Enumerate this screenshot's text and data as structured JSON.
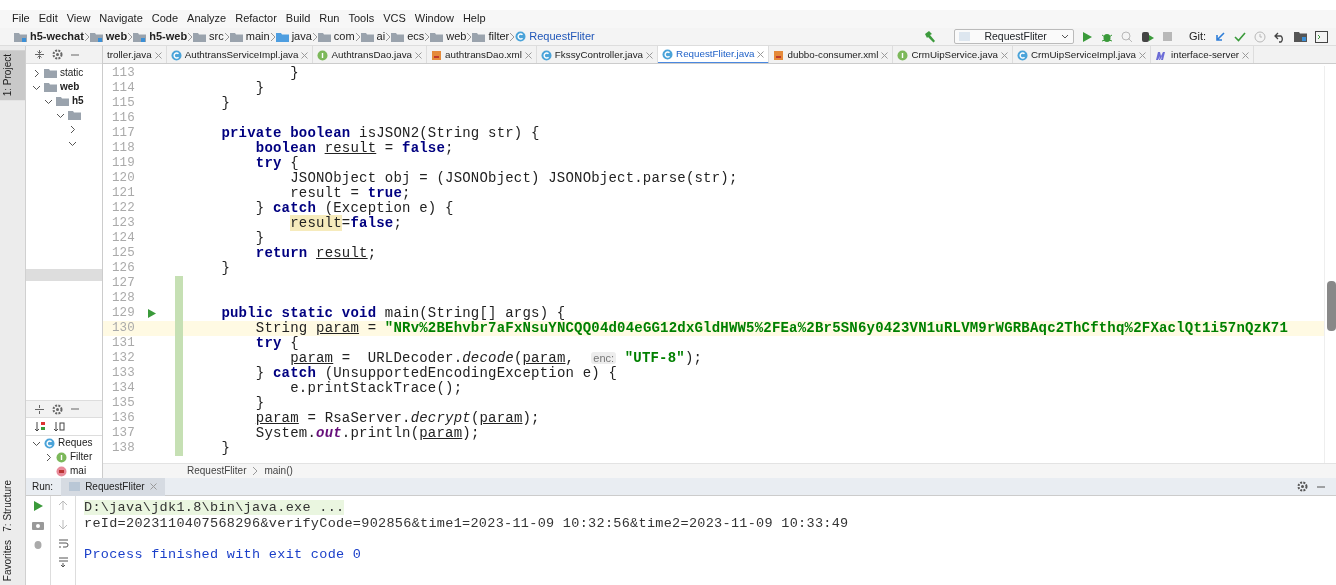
{
  "menu": [
    "File",
    "Edit",
    "View",
    "Navigate",
    "Code",
    "Analyze",
    "Refactor",
    "Build",
    "Run",
    "Tools",
    "VCS",
    "Window",
    "Help"
  ],
  "breadcrumb": [
    {
      "label": "h5-wechat",
      "kind": "module"
    },
    {
      "label": "web",
      "kind": "module"
    },
    {
      "label": "h5-web",
      "kind": "module"
    },
    {
      "label": "src",
      "kind": "folder"
    },
    {
      "label": "main",
      "kind": "folder"
    },
    {
      "label": "java",
      "kind": "source"
    },
    {
      "label": "com",
      "kind": "folder"
    },
    {
      "label": "ai",
      "kind": "folder"
    },
    {
      "label": "ecs",
      "kind": "folder"
    },
    {
      "label": "web",
      "kind": "folder"
    },
    {
      "label": "filter",
      "kind": "folder"
    },
    {
      "label": "RequestFliter",
      "kind": "class"
    }
  ],
  "toolbar": [
    {
      "kind": "build",
      "disabled": false
    },
    {
      "kind": "run_config",
      "label": "RequestFliter"
    },
    {
      "kind": "run",
      "disabled": false
    },
    {
      "kind": "debug",
      "disabled": false
    },
    {
      "kind": "coverage",
      "disabled": true
    },
    {
      "kind": "profile",
      "disabled": false
    },
    {
      "kind": "stop",
      "disabled": true
    },
    {
      "kind": "git_label",
      "label": "Git:"
    },
    {
      "kind": "update",
      "disabled": false
    },
    {
      "kind": "commit",
      "disabled": false
    },
    {
      "kind": "history",
      "disabled": true
    },
    {
      "kind": "revert",
      "disabled": false
    },
    {
      "kind": "structure",
      "disabled": false
    },
    {
      "kind": "terminal",
      "disabled": false
    }
  ],
  "tool_strip": [
    {
      "label": "1: Project",
      "selected": true
    },
    {
      "label": "7: Structure",
      "selected": false
    },
    {
      "label": "Favorites",
      "selected": false
    }
  ],
  "project_tree": [
    {
      "label": "static",
      "expanded": false
    },
    {
      "label": "web",
      "expanded": true,
      "children": [
        {
          "label": "h5",
          "expanded": true,
          "children": [
            {
              "expanded": true,
              "children": [
                {
                  "expanded": false
                },
                {
                  "expanded": true
                }
              ]
            }
          ]
        }
      ]
    }
  ],
  "structure_tree": [
    {
      "label": "Reques",
      "kind": "class",
      "expanded": true,
      "children": [
        {
          "label": "Filter",
          "kind": "interface",
          "expanded": false
        },
        {
          "label": "mai",
          "kind": "method"
        }
      ]
    }
  ],
  "tabs": [
    {
      "label": "troller.java",
      "kind": "none",
      "selected": false
    },
    {
      "label": "AuthtransServiceImpl.java",
      "kind": "class",
      "selected": false
    },
    {
      "label": "AuthtransDao.java",
      "kind": "interface",
      "selected": false
    },
    {
      "label": "authtransDao.xml",
      "kind": "xml",
      "selected": false
    },
    {
      "label": "FkssyController.java",
      "kind": "class",
      "selected": false
    },
    {
      "label": "RequestFliter.java",
      "kind": "class",
      "selected": true
    },
    {
      "label": "dubbo-consumer.xml",
      "kind": "xml",
      "selected": false
    },
    {
      "label": "CrmUipService.java",
      "kind": "interface",
      "selected": false
    },
    {
      "label": "CrmUipServiceImpl.java",
      "kind": "class",
      "selected": false
    },
    {
      "label": "interface-server",
      "kind": "module",
      "selected": false
    }
  ],
  "code": [
    {
      "number": "113",
      "tokens": [
        {
          "text": "            }",
          "kind": "plain"
        }
      ]
    },
    {
      "number": "114",
      "tokens": [
        {
          "text": "        }",
          "kind": "plain"
        }
      ]
    },
    {
      "number": "115",
      "tokens": [
        {
          "text": "    }",
          "kind": "plain"
        }
      ]
    },
    {
      "number": "116"
    },
    {
      "number": "117",
      "tokens": [
        {
          "text": "    private boolean",
          "kind": "keyword"
        },
        {
          "text": " isJSON2(String str) {",
          "kind": "plain"
        }
      ]
    },
    {
      "number": "118",
      "tokens": [
        {
          "text": "        boolean ",
          "kind": "keyword"
        },
        {
          "text": "result",
          "kind": "reassigned"
        },
        {
          "text": " = ",
          "kind": "plain"
        },
        {
          "text": "false",
          "kind": "keyword"
        },
        {
          "text": ";",
          "kind": "plain"
        }
      ]
    },
    {
      "number": "119",
      "tokens": [
        {
          "text": "        try",
          "kind": "keyword"
        },
        {
          "text": " {",
          "kind": "plain"
        }
      ]
    },
    {
      "number": "120",
      "tokens": [
        {
          "text": "            JSONObject obj = (JSONObject) JSONObject.parse(str);",
          "kind": "plain"
        }
      ]
    },
    {
      "number": "121",
      "tokens": [
        {
          "text": "            result = ",
          "kind": "plain"
        },
        {
          "text": "true",
          "kind": "keyword"
        },
        {
          "text": ";",
          "kind": "plain"
        }
      ]
    },
    {
      "number": "122",
      "tokens": [
        {
          "text": "        } ",
          "kind": "plain"
        },
        {
          "text": "catch",
          "kind": "keyword"
        },
        {
          "text": " (Exception e) {",
          "kind": "plain"
        }
      ]
    },
    {
      "number": "123",
      "tokens": [
        {
          "text": "            result",
          "kind": "highlight"
        },
        {
          "text": "=",
          "kind": "plain"
        },
        {
          "text": "false",
          "kind": "keyword"
        },
        {
          "text": ";",
          "kind": "plain"
        }
      ]
    },
    {
      "number": "124",
      "tokens": [
        {
          "text": "        }",
          "kind": "plain"
        }
      ]
    },
    {
      "number": "125",
      "tokens": [
        {
          "text": "        return ",
          "kind": "keyword"
        },
        {
          "text": "result",
          "kind": "reassigned"
        },
        {
          "text": ";",
          "kind": "plain"
        }
      ]
    },
    {
      "number": "126",
      "tokens": [
        {
          "text": "    }",
          "kind": "plain"
        }
      ]
    },
    {
      "number": "127",
      "changed": true
    },
    {
      "number": "128",
      "changed": true
    },
    {
      "number": "129",
      "changed": true,
      "run_marker": true,
      "tokens": [
        {
          "text": "    public static void",
          "kind": "keyword"
        },
        {
          "text": " main(String[] args) {",
          "kind": "plain"
        }
      ]
    },
    {
      "number": "130",
      "changed": true,
      "current": true,
      "tokens": [
        {
          "text": "        String ",
          "kind": "plain"
        },
        {
          "text": "param",
          "kind": "reassigned"
        },
        {
          "text": " = ",
          "kind": "plain"
        },
        {
          "text": "\"NRv%2BEhvbr7aFxNsuYNCQQ04d04eGG12dxGldHWW5%2FEa%2Br5SN6y0423VN1uRLVM9rWGRBAqc2ThCfthq%2FXaclQt1i57nQzK71",
          "kind": "string"
        }
      ]
    },
    {
      "number": "131",
      "changed": true,
      "tokens": [
        {
          "text": "        try",
          "kind": "keyword"
        },
        {
          "text": " {",
          "kind": "plain"
        }
      ]
    },
    {
      "number": "132",
      "changed": true,
      "tokens": [
        {
          "text": "            param",
          "kind": "reassigned"
        },
        {
          "text": " =  URLDecoder.",
          "kind": "plain"
        },
        {
          "text": "decode",
          "kind": "static"
        },
        {
          "text": "(",
          "kind": "plain"
        },
        {
          "text": "param",
          "kind": "reassigned"
        },
        {
          "text": ",  ",
          "kind": "plain"
        },
        {
          "text": "enc:",
          "kind": "hint"
        },
        {
          "text": " \"UTF-8\"",
          "kind": "string"
        },
        {
          "text": ");",
          "kind": "plain"
        }
      ]
    },
    {
      "number": "133",
      "changed": true,
      "tokens": [
        {
          "text": "        } ",
          "kind": "plain"
        },
        {
          "text": "catch",
          "kind": "keyword"
        },
        {
          "text": " (UnsupportedEncodingException e) {",
          "kind": "plain"
        }
      ]
    },
    {
      "number": "134",
      "changed": true,
      "tokens": [
        {
          "text": "            e.printStackTrace();",
          "kind": "plain"
        }
      ]
    },
    {
      "number": "135",
      "changed": true,
      "tokens": [
        {
          "text": "        }",
          "kind": "plain"
        }
      ]
    },
    {
      "number": "136",
      "changed": true,
      "tokens": [
        {
          "text": "        param",
          "kind": "reassigned"
        },
        {
          "text": " = RsaServer.",
          "kind": "plain"
        },
        {
          "text": "decrypt",
          "kind": "static"
        },
        {
          "text": "(",
          "kind": "plain"
        },
        {
          "text": "param",
          "kind": "reassigned"
        },
        {
          "text": ");",
          "kind": "plain"
        }
      ]
    },
    {
      "number": "137",
      "changed": true,
      "tokens": [
        {
          "text": "        System.",
          "kind": "plain"
        },
        {
          "text": "out",
          "kind": "field"
        },
        {
          "text": ".println(",
          "kind": "plain"
        },
        {
          "text": "param",
          "kind": "reassigned"
        },
        {
          "text": ");",
          "kind": "plain"
        }
      ]
    },
    {
      "number": "138",
      "changed": true,
      "tokens": [
        {
          "text": "    }",
          "kind": "plain"
        }
      ]
    }
  ],
  "editor_breadcrumb": [
    "RequestFliter",
    "main()"
  ],
  "run": {
    "label": "Run:",
    "tab": "RequestFliter",
    "output": [
      {
        "text": "D:\\java\\jdk1.8\\bin\\java.exe ...",
        "kind": "command"
      },
      {
        "text": "reId=2023110407568296&verifyCode=902856&time1=2023-11-09 10:32:56&time2=2023-11-09 10:33:49",
        "kind": "stdout"
      },
      {
        "kind": "blank"
      },
      {
        "text": "Process finished with exit code 0",
        "kind": "system"
      }
    ]
  }
}
